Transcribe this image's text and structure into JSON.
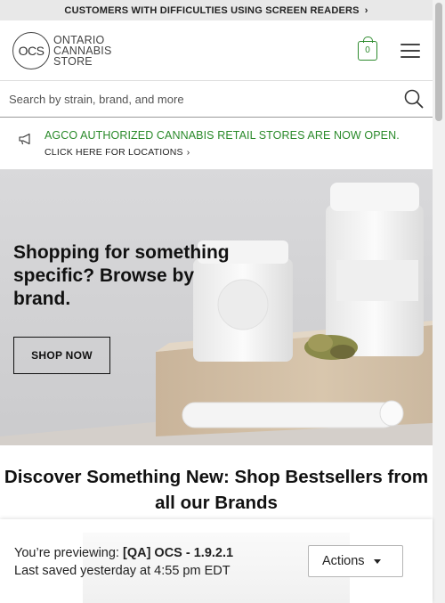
{
  "a11y_bar": {
    "text": "CUSTOMERS WITH DIFFICULTIES USING SCREEN READERS",
    "chevron": "›"
  },
  "header": {
    "logo_mark": "OCS",
    "logo_line1": "ONTARIO",
    "logo_line2": "CANNABIS",
    "logo_line3": "STORE",
    "cart_count": "0"
  },
  "search": {
    "placeholder": "Search by strain, brand, and more"
  },
  "announcement": {
    "main": "AGCO AUTHORIZED CANNABIS RETAIL STORES ARE NOW OPEN.",
    "link": "CLICK HERE FOR LOCATIONS",
    "chevron": "›"
  },
  "hero": {
    "heading": "Shopping for something specific? Browse by brand.",
    "cta": "SHOP NOW"
  },
  "discover": {
    "heading": "Discover Something New: Shop Bestsellers from all our Brands"
  },
  "preview_bar": {
    "previewing_label": "You’re previewing:",
    "previewing_value": "[QA] OCS - 1.9.2.1",
    "last_saved": "Last saved yesterday at 4:55 pm EDT",
    "actions_label": "Actions"
  },
  "colors": {
    "accent_green": "#2a8a2a",
    "a11y_bar_bg": "#e8e8e8"
  },
  "icons": [
    "chevron-right-icon",
    "cart-icon",
    "hamburger-menu-icon",
    "search-icon",
    "megaphone-icon",
    "caret-down-icon"
  ]
}
